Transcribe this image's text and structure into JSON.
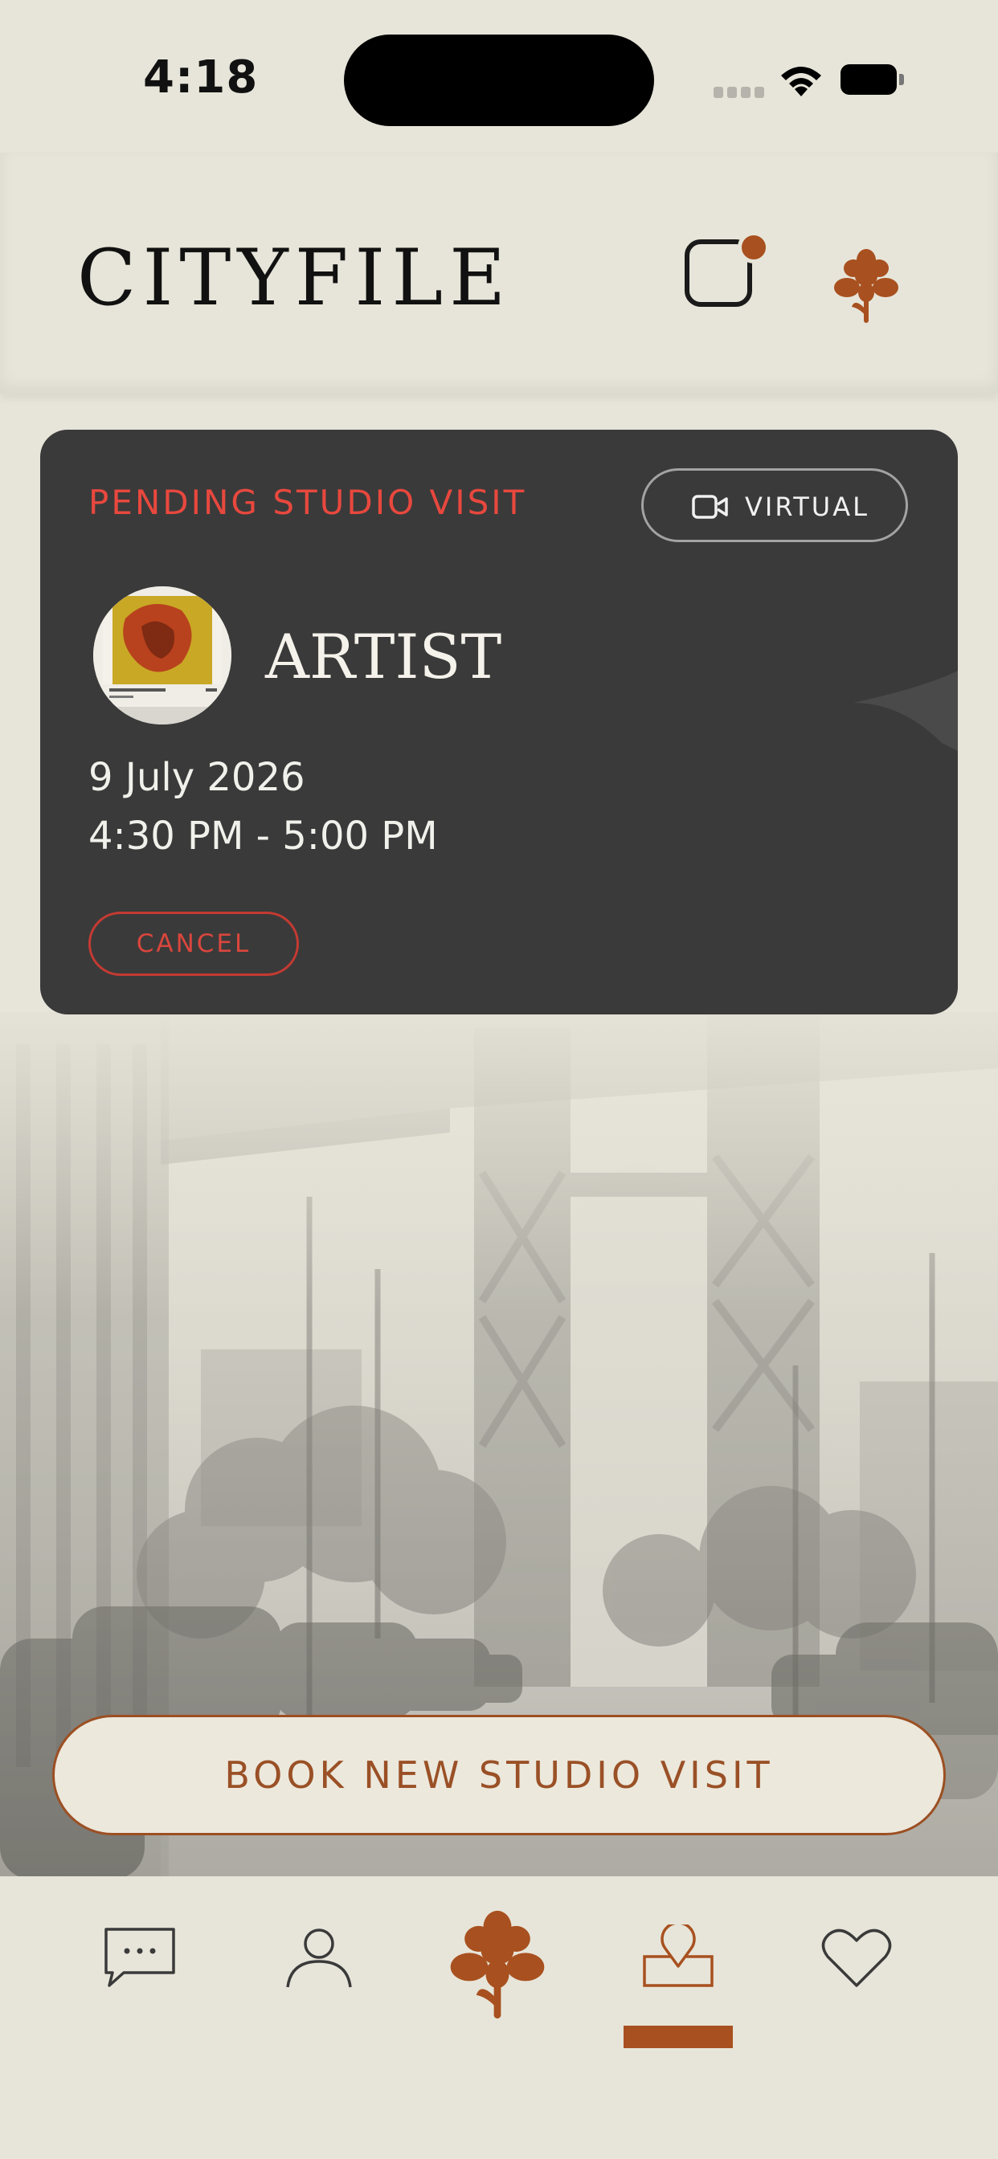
{
  "status_bar": {
    "time": "4:18"
  },
  "header": {
    "logo": "CITYFILE",
    "chat_icon": "chat-square-icon",
    "brand_icon": "iris-icon",
    "accent_color": "#a8501f"
  },
  "visit_card": {
    "status": "PENDING STUDIO VISIT",
    "mode_label": "VIRTUAL",
    "mode_icon": "video-camera-icon",
    "artist": "ARTIST",
    "date": "9 July 2026",
    "time": "4:30 PM - 5:00 PM",
    "cancel_label": "CANCEL",
    "status_color": "#e8483e"
  },
  "book_button": {
    "label": "BOOK NEW STUDIO VISIT"
  },
  "tab_bar": {
    "items": [
      {
        "name": "messages",
        "icon": "speech-bubble-icon"
      },
      {
        "name": "profile",
        "icon": "person-icon"
      },
      {
        "name": "home",
        "icon": "iris-icon"
      },
      {
        "name": "visits",
        "icon": "map-pin-icon",
        "active": true
      },
      {
        "name": "favorites",
        "icon": "heart-icon"
      }
    ]
  }
}
